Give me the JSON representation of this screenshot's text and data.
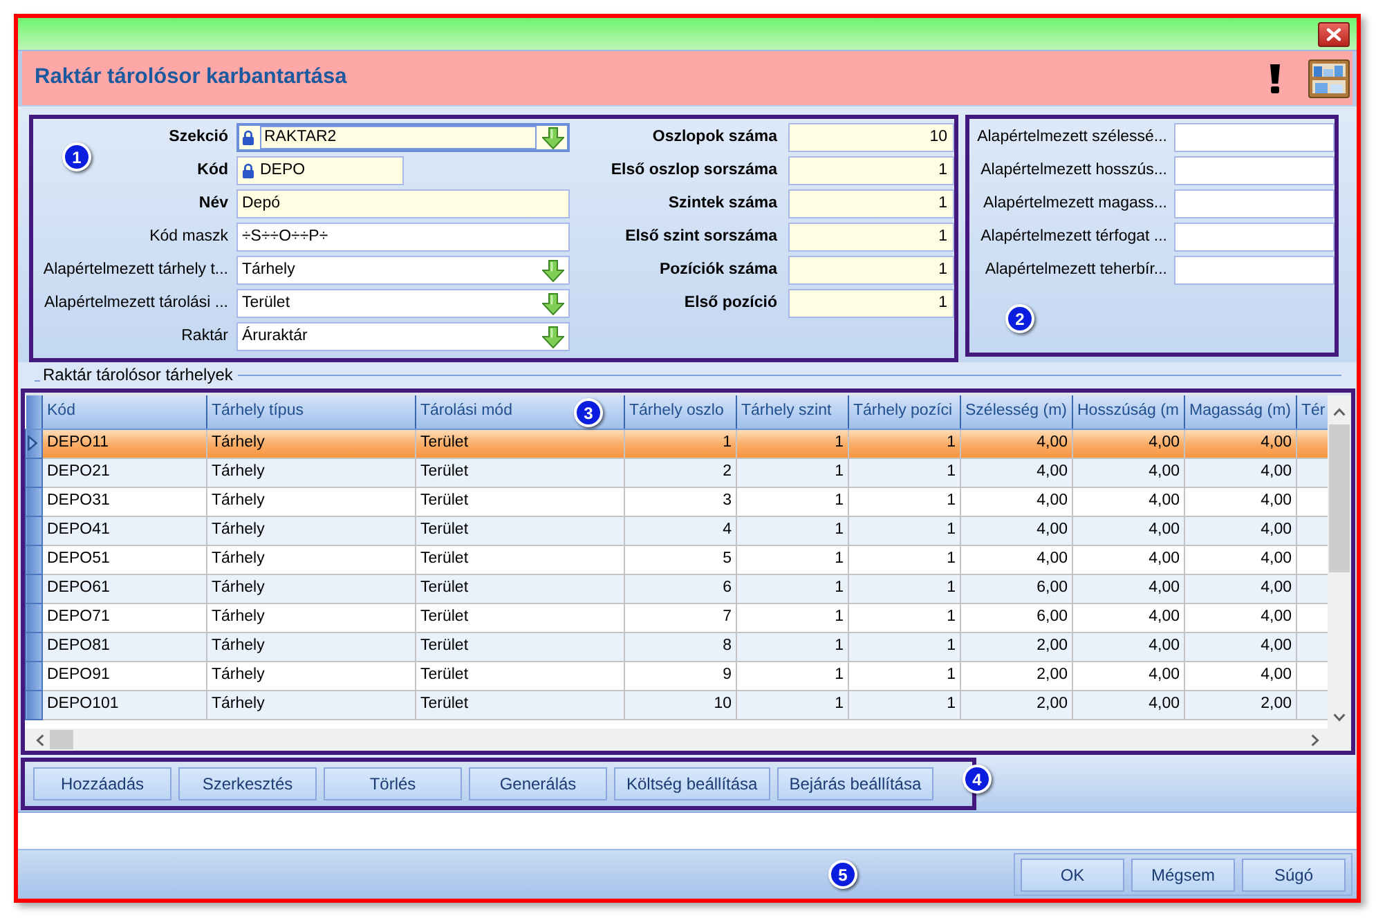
{
  "window": {
    "title": "Raktár tárolósor karbantartása"
  },
  "main_panel": {
    "callout": "1",
    "left_fields": [
      {
        "label": "Szekció",
        "value": "RAKTAR2",
        "kind": "dropdown",
        "required": true,
        "locked": true,
        "focused": true
      },
      {
        "label": "Kód",
        "value": "DEPO",
        "kind": "short",
        "required": true,
        "locked": true,
        "focused": false
      },
      {
        "label": "Név",
        "value": "Depó",
        "kind": "text",
        "required": true,
        "locked": false,
        "focused": false
      },
      {
        "label": "Kód maszk",
        "value": "÷S÷÷O÷÷P÷",
        "kind": "text",
        "required": false,
        "locked": false,
        "focused": false
      },
      {
        "label": "Alapértelmezett tárhely t...",
        "value": "Tárhely",
        "kind": "dropdown",
        "required": false,
        "locked": false,
        "focused": false
      },
      {
        "label": "Alapértelmezett tárolási ...",
        "value": "Terület",
        "kind": "dropdown",
        "required": false,
        "locked": false,
        "focused": false
      },
      {
        "label": "Raktár",
        "value": "Áruraktár",
        "kind": "dropdown",
        "required": false,
        "locked": false,
        "focused": false
      }
    ],
    "right_fields": [
      {
        "label": "Oszlopok száma",
        "value": "10",
        "kind": "number",
        "required": true
      },
      {
        "label": "Első oszlop sorszáma",
        "value": "1",
        "kind": "number",
        "required": true
      },
      {
        "label": "Szintek száma",
        "value": "1",
        "kind": "number",
        "required": true
      },
      {
        "label": "Első szint sorszáma",
        "value": "1",
        "kind": "number",
        "required": true
      },
      {
        "label": "Pozíciók száma",
        "value": "1",
        "kind": "number",
        "required": true
      },
      {
        "label": "Első pozíció",
        "value": "1",
        "kind": "number",
        "required": true
      }
    ]
  },
  "defaults_panel": {
    "callout": "2",
    "fields": [
      {
        "label": "Alapértelmezett szélessé...",
        "required": false
      },
      {
        "label": "Alapértelmezett hosszús...",
        "required": false
      },
      {
        "label": "Alapértelmezett magass...",
        "required": false
      },
      {
        "label": "Alapértelmezett térfogat ...",
        "required": false
      },
      {
        "label": "Alapértelmezett teherbír...",
        "required": false
      }
    ]
  },
  "grid_group": {
    "title": "Raktár tárolósor tárhelyek"
  },
  "table": {
    "callout": "3",
    "columns": [
      {
        "label": "Kód",
        "kind": "text"
      },
      {
        "label": "Tárhely típus",
        "kind": "text"
      },
      {
        "label": "Tárolási mód",
        "kind": "text"
      },
      {
        "label": "Tárhely oszlo",
        "kind": "number"
      },
      {
        "label": "Tárhely szint",
        "kind": "number"
      },
      {
        "label": "Tárhely pozíci",
        "kind": "number"
      },
      {
        "label": "Szélesség (m)",
        "kind": "number"
      },
      {
        "label": "Hosszúság (m",
        "kind": "number"
      },
      {
        "label": "Magasság (m)",
        "kind": "number"
      },
      {
        "label": "Tér"
      }
    ],
    "rows": [
      {
        "selected": true,
        "cells": [
          "DEPO11",
          "Tárhely",
          "Terület",
          "1",
          "1",
          "1",
          "4,00",
          "4,00",
          "4,00"
        ]
      },
      {
        "selected": false,
        "cells": [
          "DEPO21",
          "Tárhely",
          "Terület",
          "2",
          "1",
          "1",
          "4,00",
          "4,00",
          "4,00"
        ]
      },
      {
        "selected": false,
        "cells": [
          "DEPO31",
          "Tárhely",
          "Terület",
          "3",
          "1",
          "1",
          "4,00",
          "4,00",
          "4,00"
        ]
      },
      {
        "selected": false,
        "cells": [
          "DEPO41",
          "Tárhely",
          "Terület",
          "4",
          "1",
          "1",
          "4,00",
          "4,00",
          "4,00"
        ]
      },
      {
        "selected": false,
        "cells": [
          "DEPO51",
          "Tárhely",
          "Terület",
          "5",
          "1",
          "1",
          "4,00",
          "4,00",
          "4,00"
        ]
      },
      {
        "selected": false,
        "cells": [
          "DEPO61",
          "Tárhely",
          "Terület",
          "6",
          "1",
          "1",
          "6,00",
          "4,00",
          "4,00"
        ]
      },
      {
        "selected": false,
        "cells": [
          "DEPO71",
          "Tárhely",
          "Terület",
          "7",
          "1",
          "1",
          "6,00",
          "4,00",
          "4,00"
        ]
      },
      {
        "selected": false,
        "cells": [
          "DEPO81",
          "Tárhely",
          "Terület",
          "8",
          "1",
          "1",
          "2,00",
          "4,00",
          "4,00"
        ]
      },
      {
        "selected": false,
        "cells": [
          "DEPO91",
          "Tárhely",
          "Terület",
          "9",
          "1",
          "1",
          "2,00",
          "4,00",
          "4,00"
        ]
      },
      {
        "selected": false,
        "cells": [
          "DEPO101",
          "Tárhely",
          "Terület",
          "10",
          "1",
          "1",
          "2,00",
          "4,00",
          "2,00"
        ]
      }
    ]
  },
  "action_bar": {
    "callout": "4",
    "buttons": [
      "Hozzáadás",
      "Szerkesztés",
      "Törlés",
      "Generálás",
      "Költség beállítása",
      "Bejárás beállítása"
    ]
  },
  "footer": {
    "callout": "5",
    "buttons": [
      "OK",
      "Mégsem",
      "Súgó"
    ]
  }
}
